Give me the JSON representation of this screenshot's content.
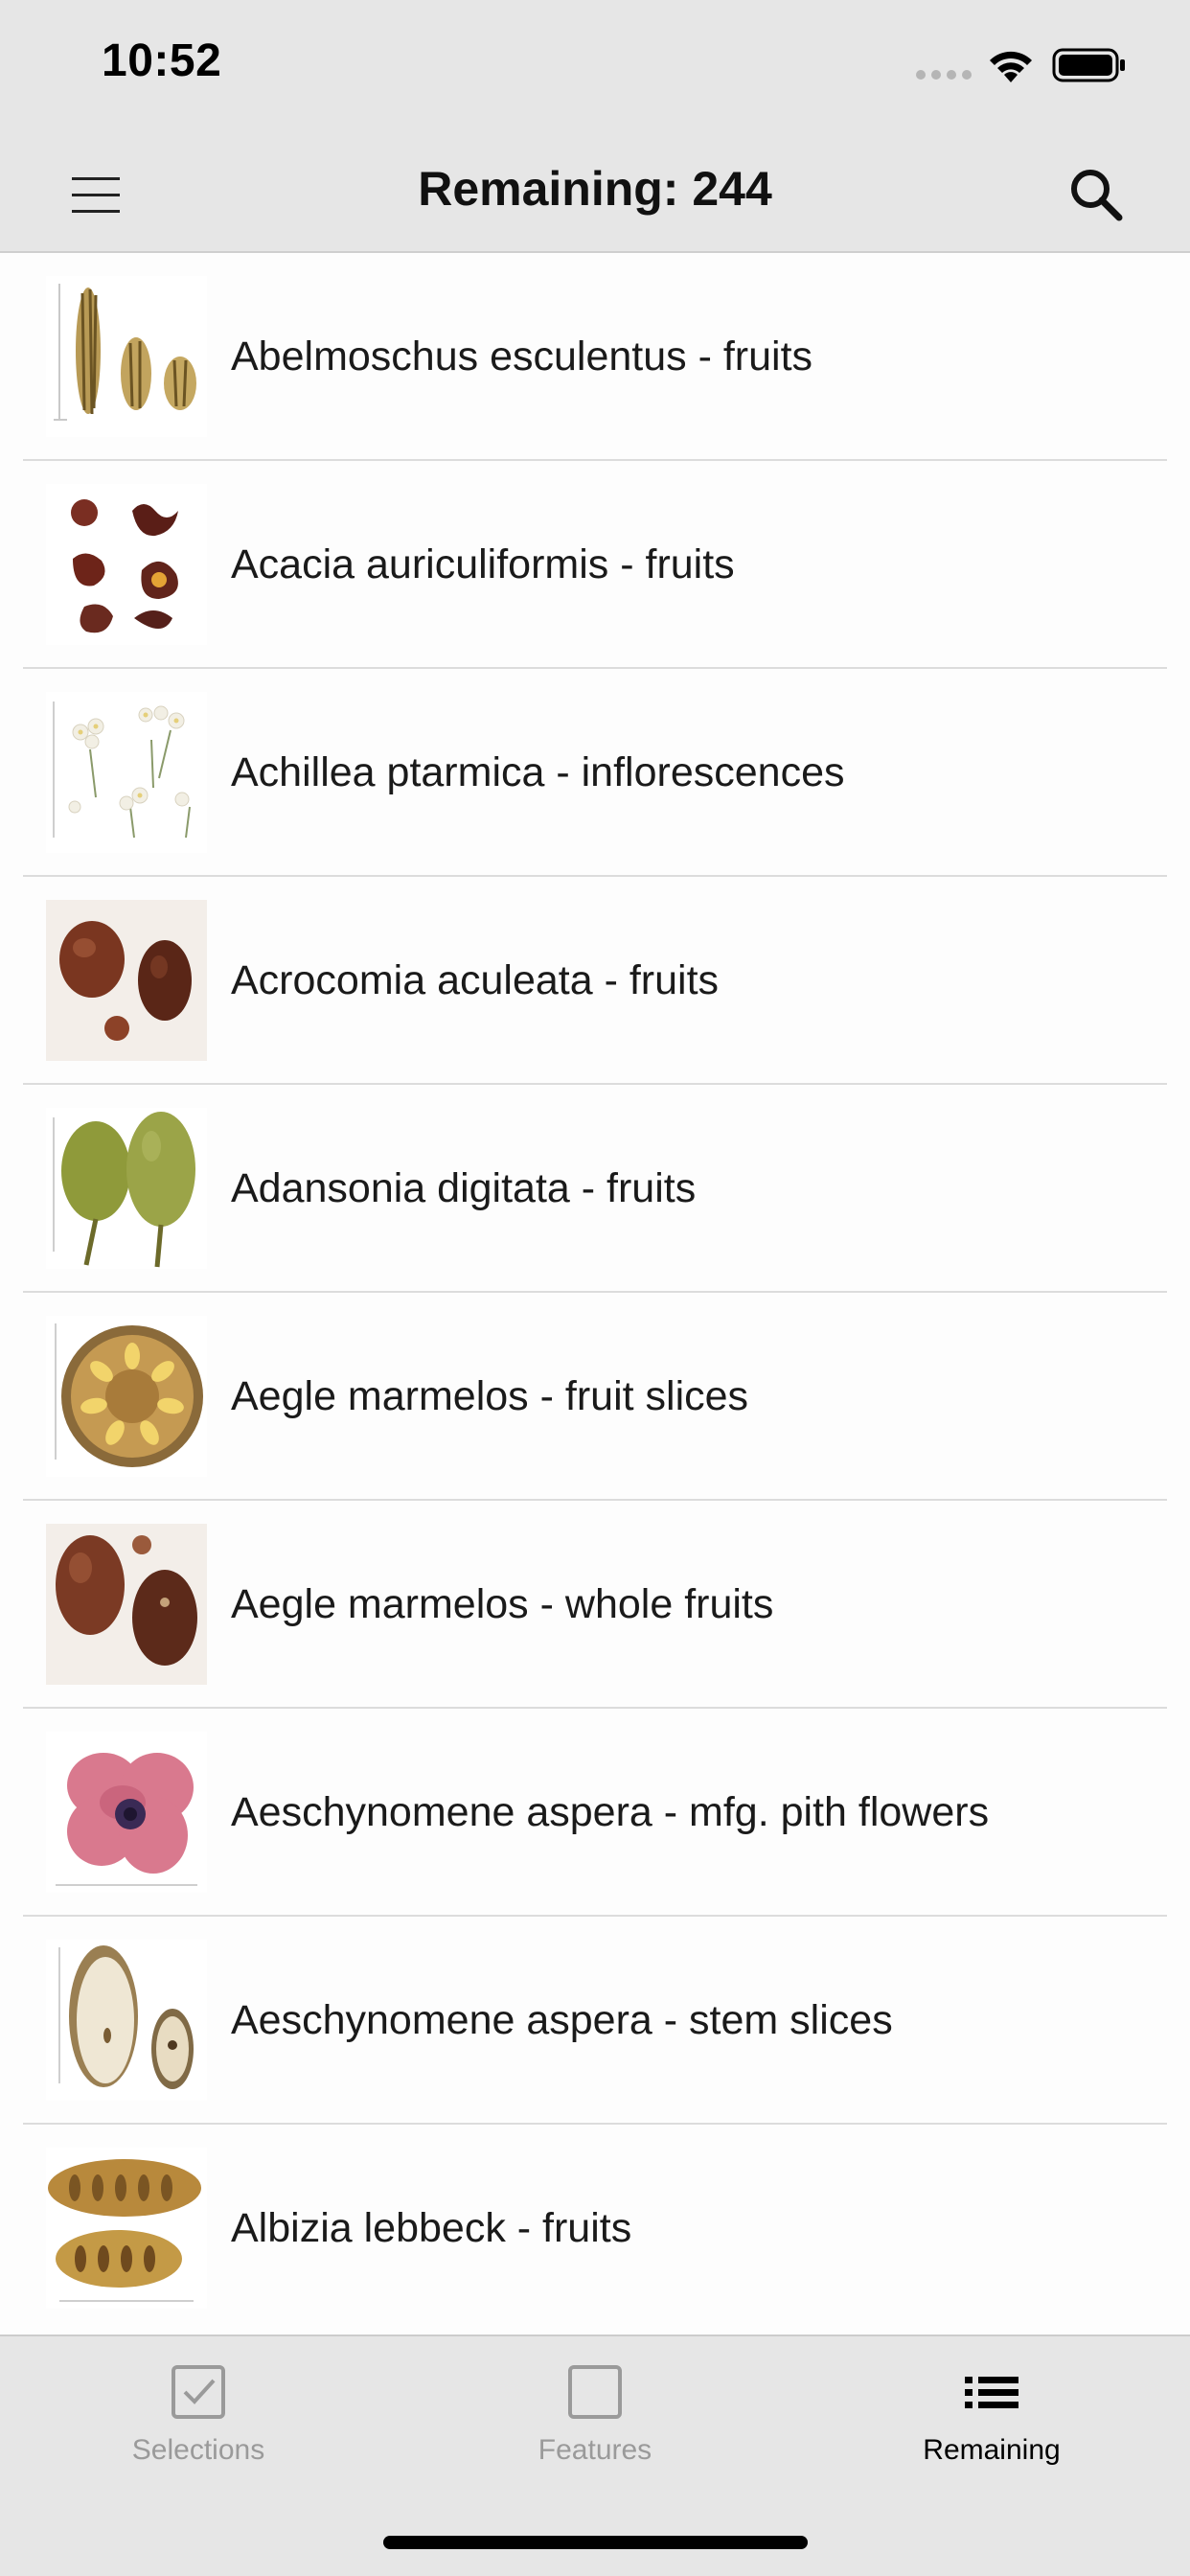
{
  "status_bar": {
    "time": "10:52"
  },
  "nav": {
    "title": "Remaining: 244",
    "menu_icon": "hamburger-menu-icon",
    "search_icon": "search-icon"
  },
  "items": [
    {
      "label": "Abelmoschus esculentus - fruits",
      "thumb": "okra-pods"
    },
    {
      "label": "Acacia auriculiformis - fruits",
      "thumb": "twisted-pods"
    },
    {
      "label": "Achillea ptarmica - inflorescences",
      "thumb": "white-flowers"
    },
    {
      "label": "Acrocomia aculeata - fruits",
      "thumb": "brown-round-fruits"
    },
    {
      "label": "Adansonia digitata - fruits",
      "thumb": "green-pods"
    },
    {
      "label": "Aegle marmelos - fruit slices",
      "thumb": "fruit-slice"
    },
    {
      "label": "Aegle marmelos - whole fruits",
      "thumb": "brown-round-fruits"
    },
    {
      "label": "Aeschynomene aspera - mfg. pith flowers",
      "thumb": "pink-flower"
    },
    {
      "label": "Aeschynomene aspera - stem slices",
      "thumb": "stem-slices"
    },
    {
      "label": "Albizia lebbeck - fruits",
      "thumb": "flat-pods"
    }
  ],
  "tabs": [
    {
      "label": "Selections",
      "icon": "checkbox-checked-icon",
      "active": false
    },
    {
      "label": "Features",
      "icon": "checkbox-empty-icon",
      "active": false
    },
    {
      "label": "Remaining",
      "icon": "list-icon",
      "active": true
    }
  ],
  "colors": {
    "bar_background": "#e6e6e6",
    "active_tab": "#000000",
    "inactive_tab": "#9a9a9a"
  }
}
